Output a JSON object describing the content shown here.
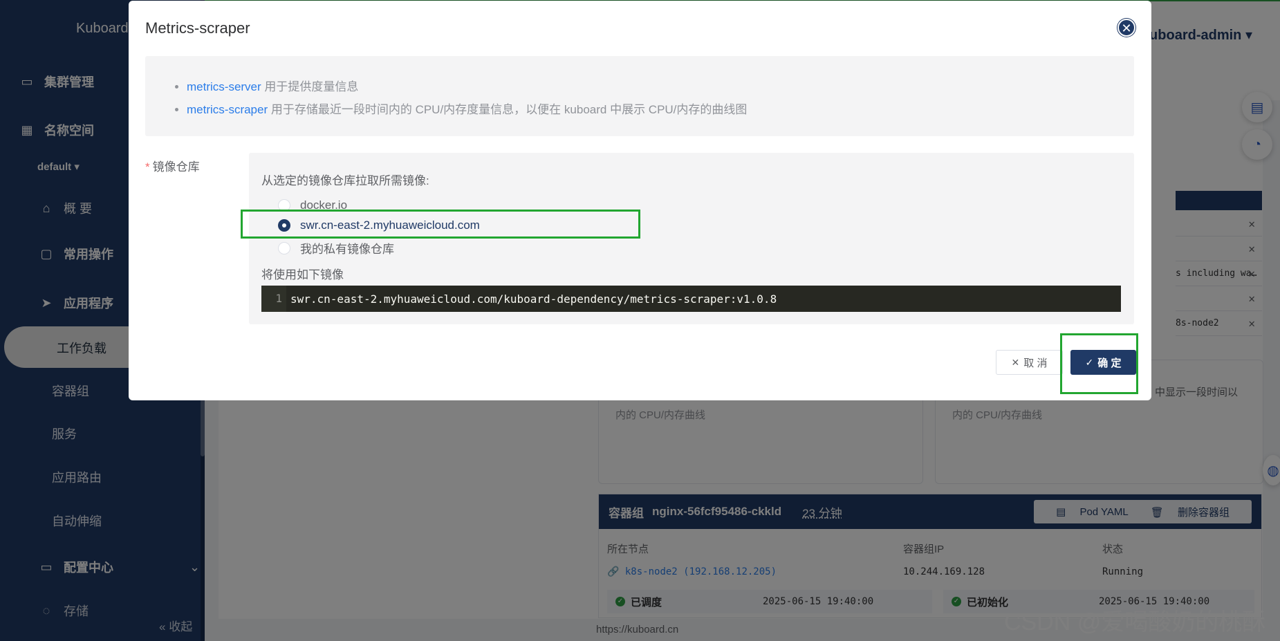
{
  "app": {
    "logo": "Kuboard",
    "user": "kuboard-admin",
    "footer_url": "https://kuboard.cn",
    "watermark": "CSDN @爱喝酸奶的桃酥"
  },
  "sidebar": {
    "cluster_mgmt": "集群管理",
    "namespace": "名称空间",
    "namespace_value": "default",
    "overview": "概 要",
    "common_ops": "常用操作",
    "applications": "应用程序",
    "workloads": "工作负载",
    "pods": "容器组",
    "services": "服务",
    "ingress": "应用路由",
    "autoscale": "自动伸缩",
    "config_center": "配置中心",
    "storage": "存储",
    "collapse": "收起"
  },
  "background": {
    "card_note_1": "内的 CPU/内存曲线",
    "card_note_2": "内的 CPU/内存曲线",
    "right_note": "中显示一段时间以",
    "right_list": [
      "",
      "",
      "s including wa…",
      "",
      "8s-node2"
    ],
    "pod": {
      "label": "容器组",
      "name": "nginx-56fcf95486-ckkld",
      "age": "23 分钟",
      "yaml_btn": "Pod YAML",
      "delete_btn": "删除容器组",
      "col_node": "所在节点",
      "col_ip": "容器组IP",
      "col_status": "状态",
      "node_value": "k8s-node2 (192.168.12.205)",
      "ip_value": "10.244.169.128",
      "status_value": "Running",
      "scheduled": "已调度",
      "scheduled_time": "2025-06-15 19:40:00",
      "initialized": "已初始化",
      "initialized_time": "2025-06-15 19:40:00"
    }
  },
  "dialog": {
    "title": "Metrics-scraper",
    "info": [
      {
        "link": "metrics-server",
        "text": " 用于提供度量信息"
      },
      {
        "link": "metrics-scraper",
        "text": " 用于存储最近一段时间内的 CPU/内存度量信息，以便在 kuboard 中展示 CPU/内存的曲线图"
      }
    ],
    "repo_label": "镜像仓库",
    "repo_tip": "从选定的镜像仓库拉取所需镜像:",
    "options": [
      "docker.io",
      "swr.cn-east-2.myhuaweicloud.com",
      "我的私有镜像仓库"
    ],
    "selected_option": "swr.cn-east-2.myhuaweicloud.com",
    "use_label": "将使用如下镜像",
    "code_line_no": "1",
    "code": "swr.cn-east-2.myhuaweicloud.com/kuboard-dependency/metrics-scraper:v1.0.8",
    "cancel": "取 消",
    "confirm": "确 定"
  },
  "colors": {
    "brand": "#203a66",
    "link": "#2b7de9",
    "highlight": "#22a630"
  }
}
